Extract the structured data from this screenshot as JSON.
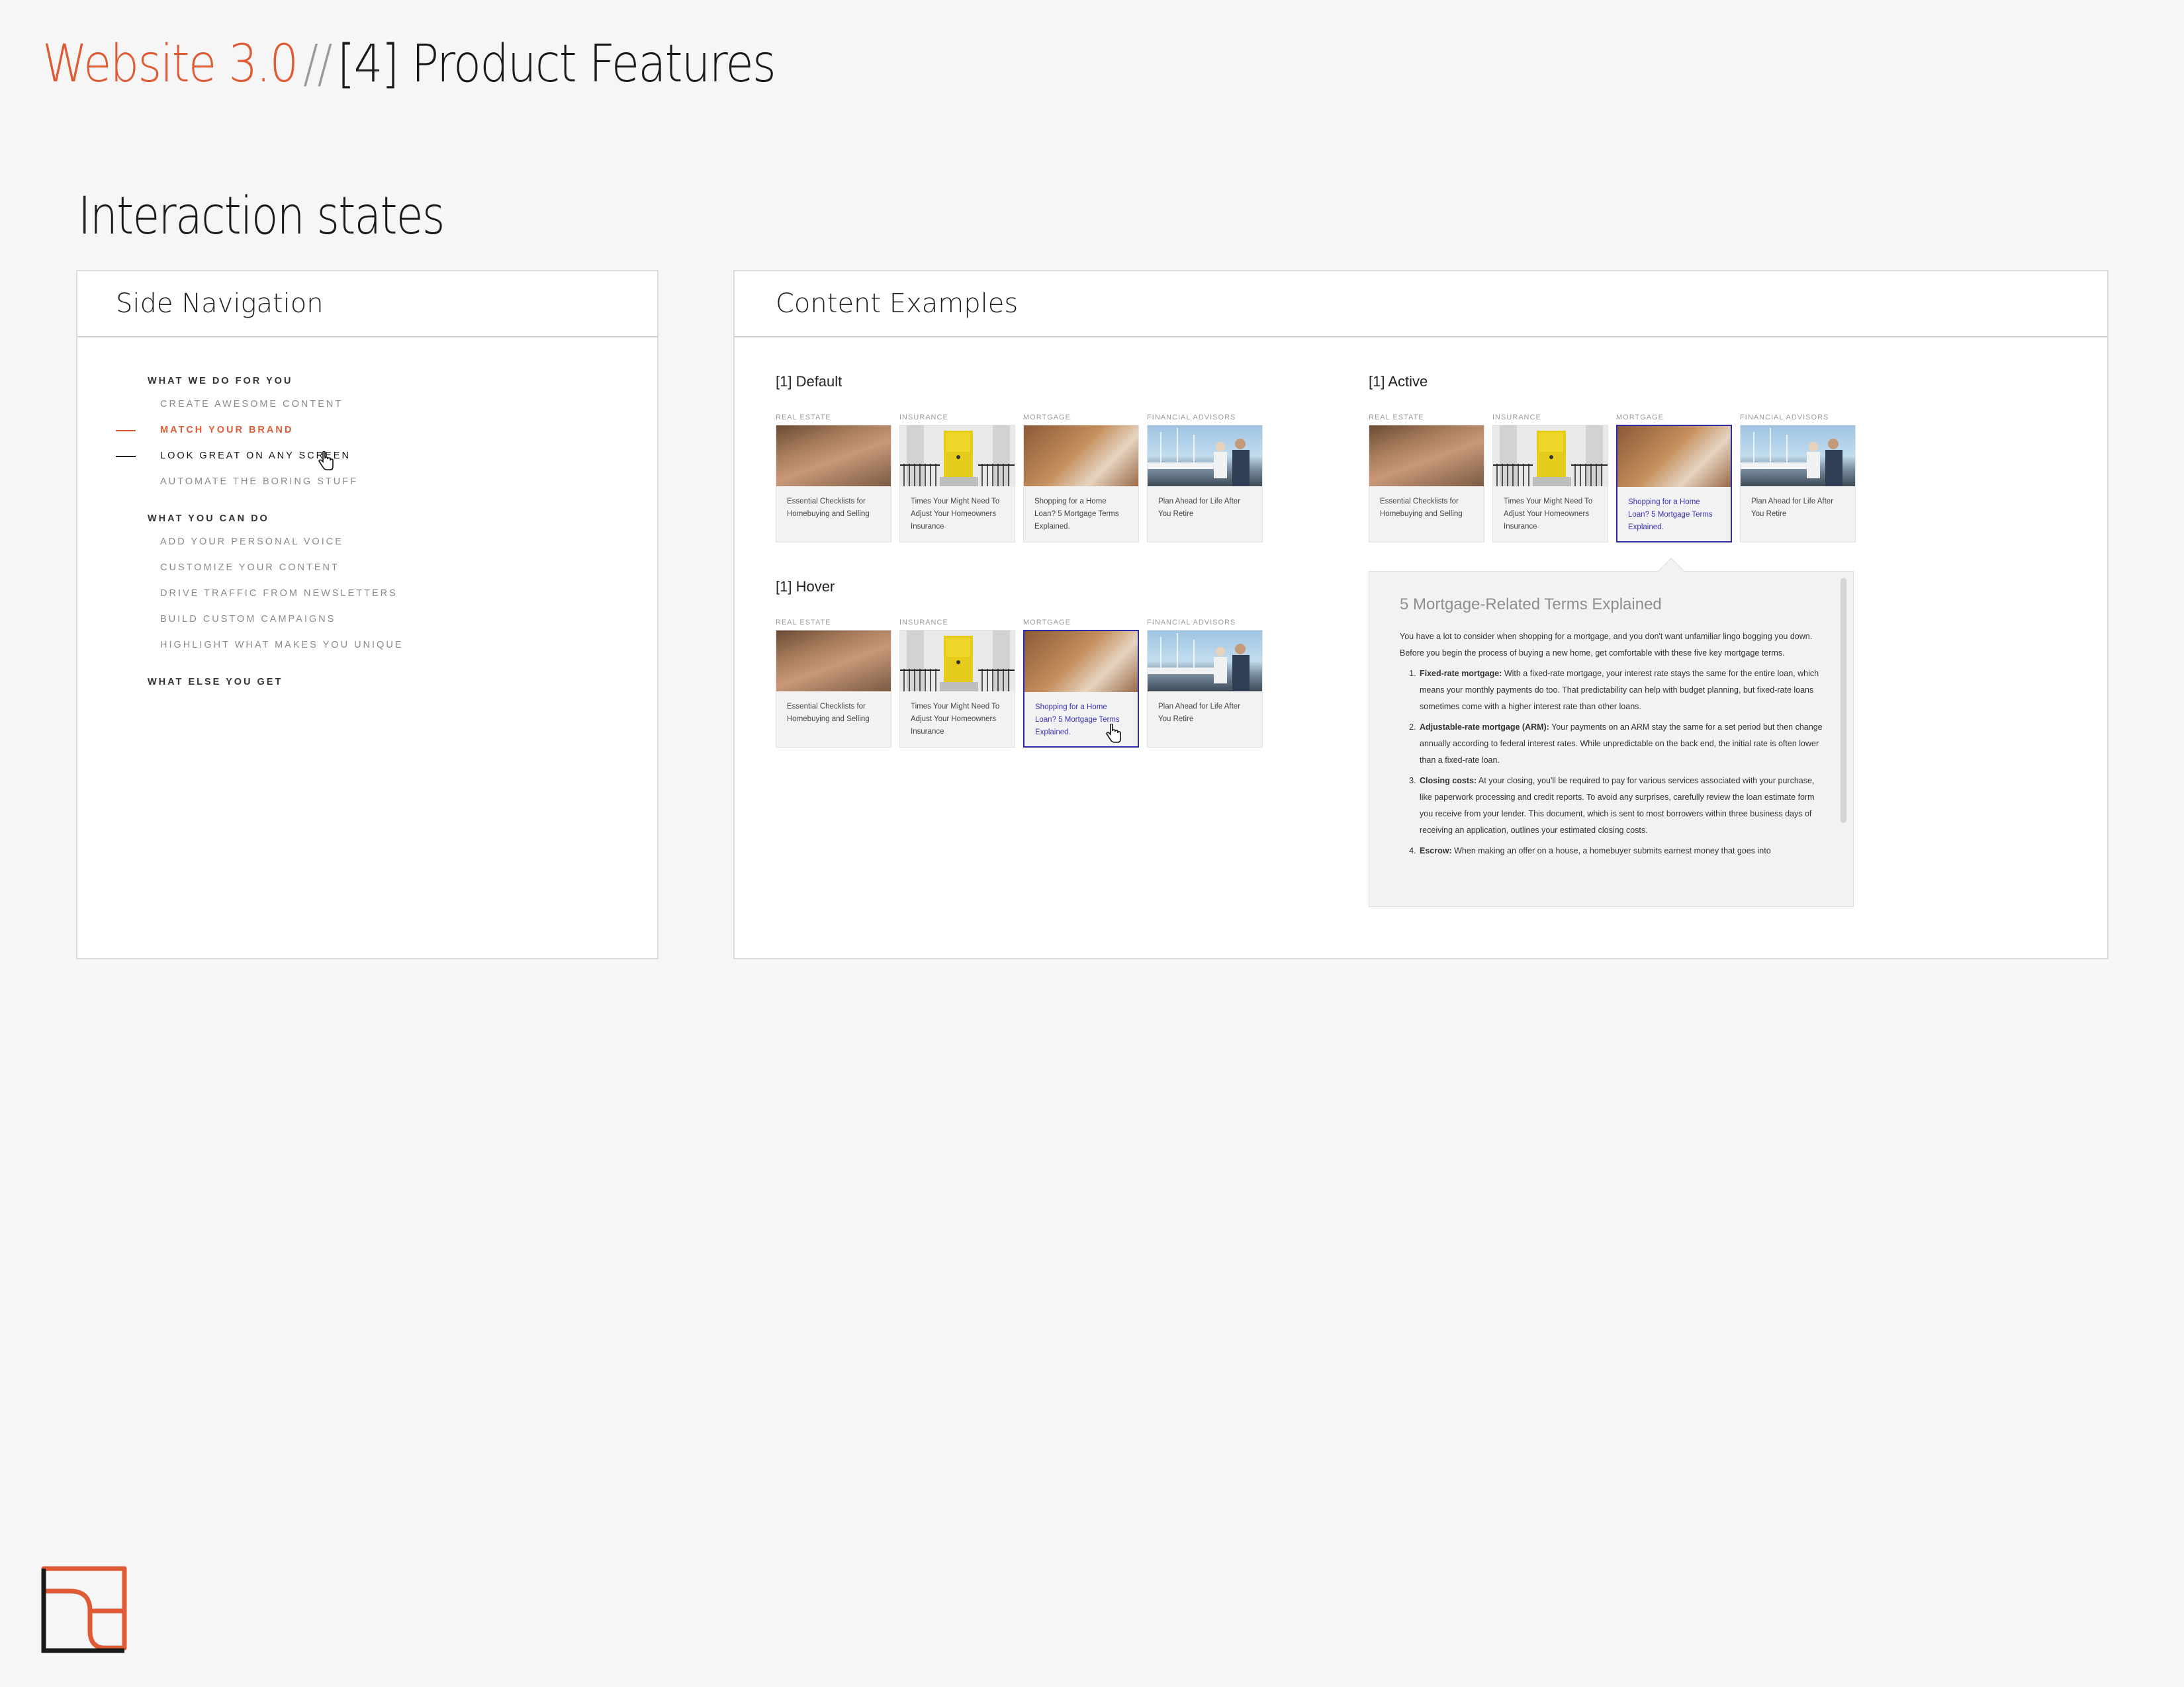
{
  "header": {
    "site": "Website 3.0",
    "separator": "//",
    "page": "[4] Product Features"
  },
  "section_title": "Interaction states",
  "side_nav": {
    "title": "Side Navigation",
    "groups": [
      {
        "label": "WHAT WE DO FOR YOU",
        "items": [
          "CREATE AWESOME CONTENT",
          "MATCH YOUR BRAND",
          "LOOK GREAT ON ANY SCREEN",
          "AUTOMATE THE BORING STUFF"
        ]
      },
      {
        "label": "WHAT YOU CAN DO",
        "items": [
          "ADD YOUR PERSONAL VOICE",
          "CUSTOMIZE YOUR CONTENT",
          "DRIVE TRAFFIC FROM NEWSLETTERS",
          "BUILD CUSTOM CAMPAIGNS",
          "HIGHLIGHT WHAT MAKES YOU UNIQUE"
        ]
      },
      {
        "label": "WHAT ELSE YOU GET",
        "items": []
      }
    ],
    "active_item": "MATCH YOUR BRAND",
    "hover_item": "LOOK GREAT ON ANY SCREEN"
  },
  "content_examples": {
    "title": "Content Examples",
    "states": {
      "default": "[1] Default",
      "hover": "[1] Hover",
      "active": "[1] Active"
    },
    "cards": [
      {
        "category": "REAL ESTATE",
        "title": "Essential Checklists for Homebuying and Selling"
      },
      {
        "category": "INSURANCE",
        "title": "Times Your Might Need To Adjust Your Homeowners Insurance"
      },
      {
        "category": "MORTGAGE",
        "title": "Shopping for a Home Loan? 5 Mortgage Terms Explained."
      },
      {
        "category": "FINANCIAL ADVISORS",
        "title": "Plan Ahead for Life After You Retire"
      }
    ],
    "popover": {
      "title": "5 Mortgage-Related Terms Explained",
      "intro": "You have a lot to consider when shopping for a mortgage, and you don't want unfamiliar lingo bogging you down. Before you begin the process of buying a new home, get comfortable with these five key mortgage terms.",
      "items": [
        {
          "term": "Fixed-rate mortgage:",
          "text": "With a fixed-rate mortgage, your interest rate stays the same for the entire loan, which means your monthly payments do too. That predictability can help with budget planning, but fixed-rate loans sometimes come with a higher interest rate than other loans."
        },
        {
          "term": "Adjustable-rate mortgage (ARM):",
          "text": "Your payments on an ARM stay the same for a set period but then change annually according to federal interest rates. While unpredictable on the back end, the initial rate is often lower than a fixed-rate loan."
        },
        {
          "term": "Closing costs:",
          "text": "At your closing, you'll be required to pay for various services associated with your purchase, like paperwork processing and credit reports. To avoid any surprises, carefully review the loan estimate form you receive from your lender. This document, which is sent to most borrowers within three business days of receiving an application, outlines your estimated closing costs."
        },
        {
          "term": "Escrow:",
          "text": "When making an offer on a house, a homebuyer submits earnest money that goes into"
        }
      ]
    }
  },
  "colors": {
    "brand_orange": "#e05a33",
    "active_blue": "#2b2aa8",
    "panel_border": "#dcdcdc"
  }
}
